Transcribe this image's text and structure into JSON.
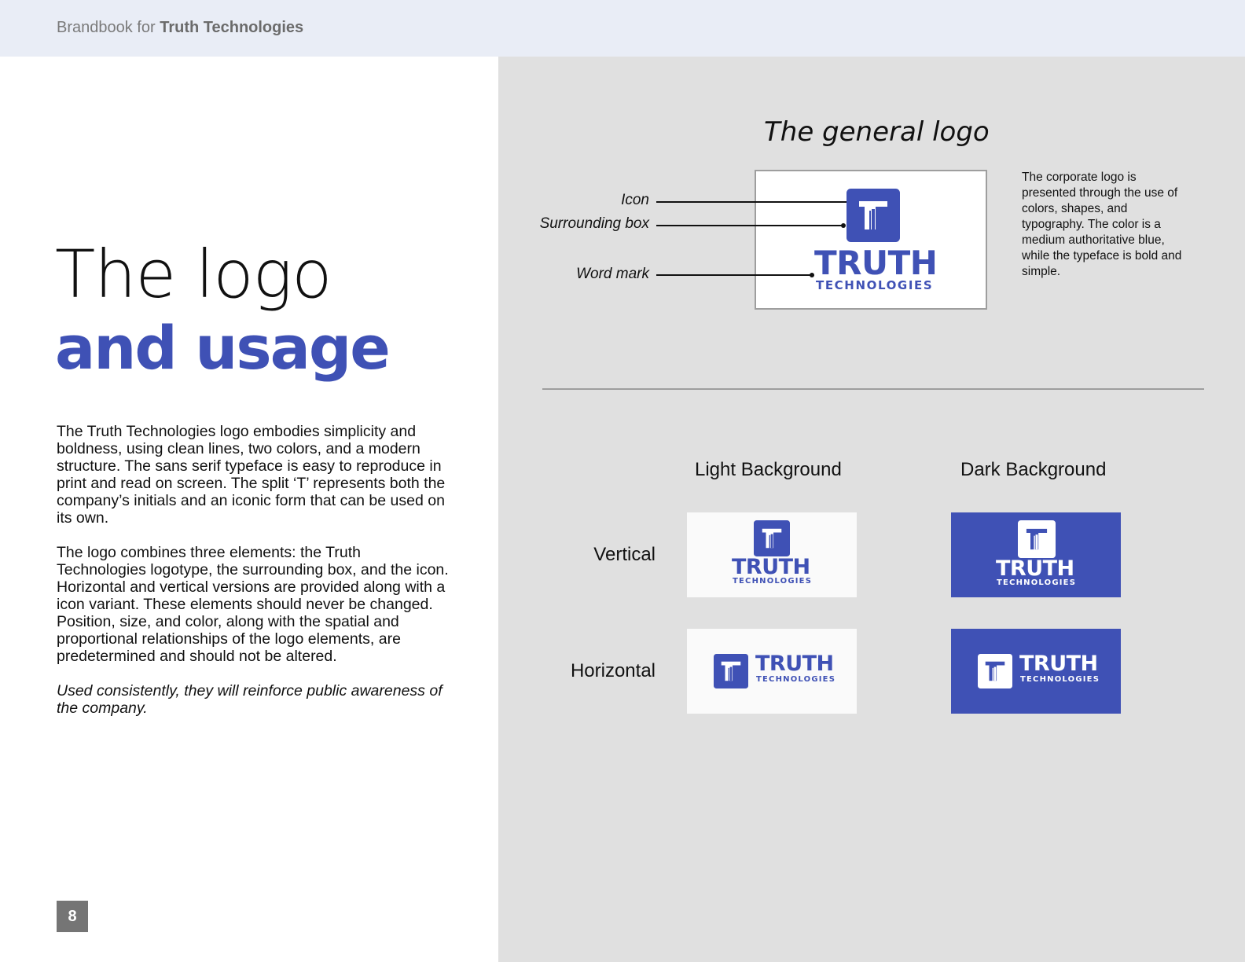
{
  "header": {
    "prefix": "Brandbook for",
    "company": "Truth Technologies"
  },
  "title": {
    "line1": "The logo",
    "line2": "and usage"
  },
  "body": {
    "paragraph1": "The Truth Technologies logo embodies simplicity and boldness, using clean lines, two colors, and a modern structure.  The sans serif typeface is easy to reproduce in print and read on screen.  The split ‘T’ represents both the company’s initials and an iconic form that can be used on its own.",
    "paragraph2": "The logo combines three elements: the Truth Technologies logotype, the surrounding box, and the icon.  Horizontal and vertical versions are provided along with a icon variant.  These elements should never be changed.  Position, size, and color, along with the spatial and proportional relationships of the logo elements, are predetermined and should not be altered.",
    "paragraph3": "Used consistently, they will reinforce public awareness of the company."
  },
  "page_number": "8",
  "general_logo": {
    "title": "The general logo",
    "callouts": {
      "icon": "Icon",
      "surrounding_box": "Surrounding box",
      "word_mark": "Word mark"
    },
    "description": "The corporate logo is presented through the use of colors, shapes, and typography.  The color is a medium authoritative blue, while the typeface is bold and simple."
  },
  "logo": {
    "wordmark": "TRUTH",
    "subline": "TECHNOLOGIES"
  },
  "variants": {
    "col_light": "Light Background",
    "col_dark": "Dark Background",
    "row_vertical": "Vertical",
    "row_horizontal": "Horizontal"
  },
  "colors": {
    "brand_blue": "#3f51b5",
    "light_bg": "#fafafa",
    "panel_bg": "#e0e0e0",
    "header_bg": "#e9edf6"
  },
  "icons": {
    "logo_icon": "split-t-icon"
  }
}
